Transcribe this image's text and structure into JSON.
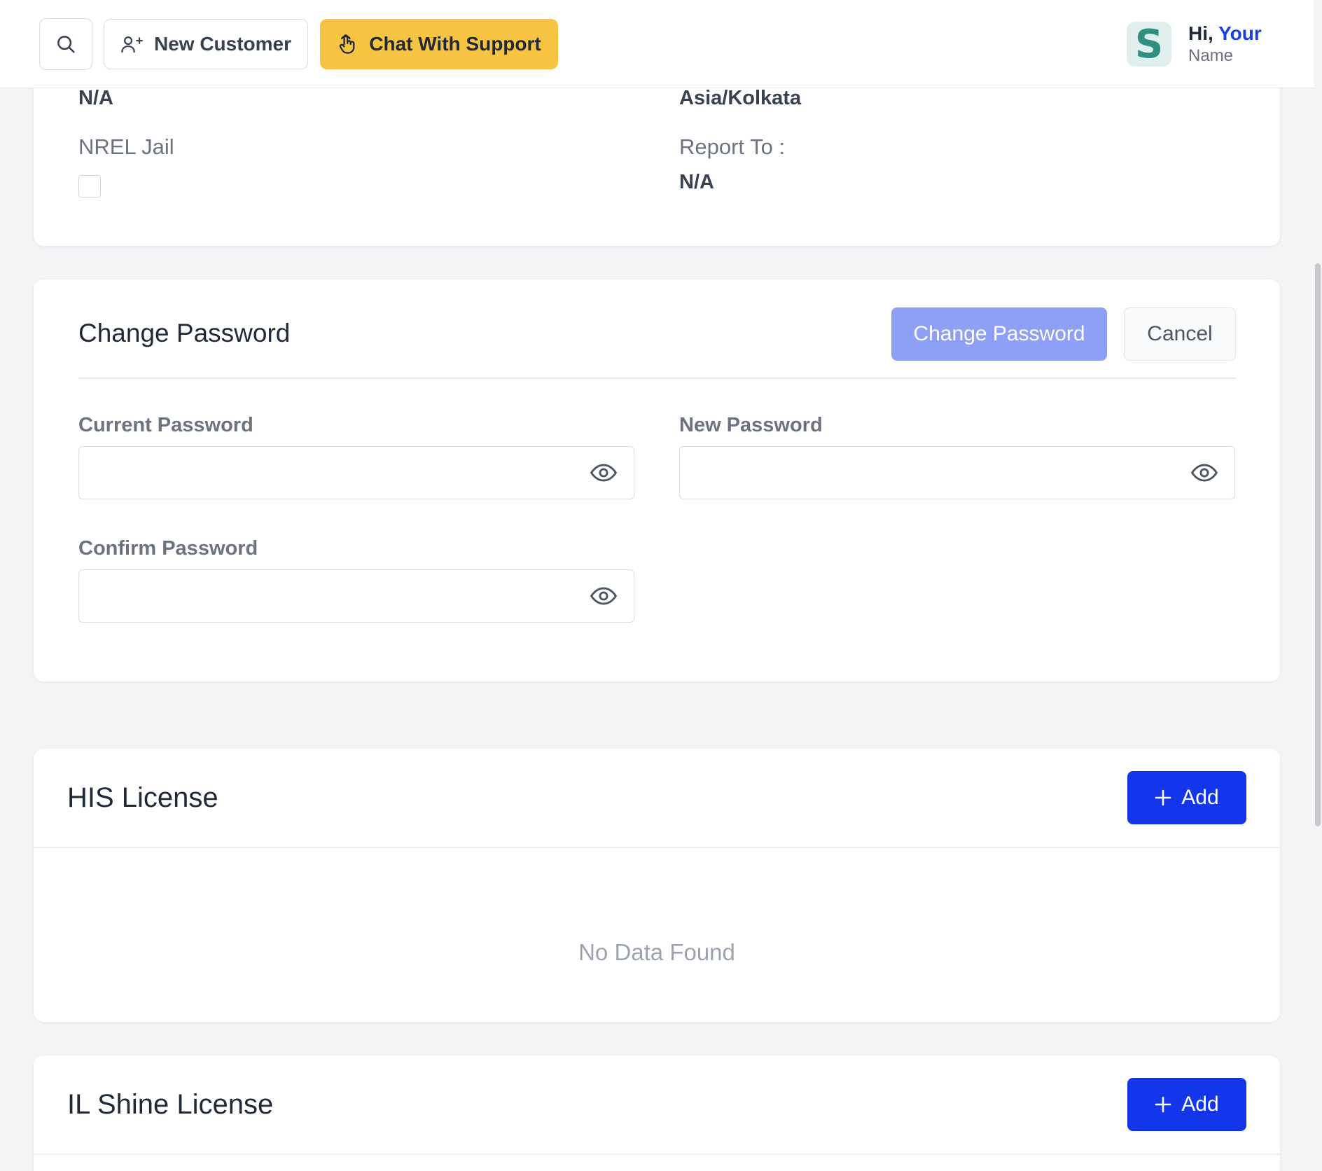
{
  "topbar": {
    "new_customer_label": "New Customer",
    "support_label": "Chat With Support",
    "avatar_letter": "S",
    "greeting_hi": "Hi,",
    "greeting_your": "Your",
    "greeting_name": "Name",
    "support_color": "#f6c343"
  },
  "profile": {
    "left_value_top": "N/A",
    "right_value_top": "Asia/Kolkata",
    "nrel_label": "NREL Jail",
    "report_to_label": "Report To :",
    "report_to_value": "N/A"
  },
  "change_password": {
    "title": "Change Password",
    "submit_label": "Change Password",
    "cancel_label": "Cancel",
    "current_label": "Current Password",
    "current_value": "",
    "new_label": "New Password",
    "new_value": "",
    "confirm_label": "Confirm Password",
    "confirm_value": ""
  },
  "his_license": {
    "title": "HIS License",
    "add_label": "Add",
    "empty_text": "No Data Found"
  },
  "il_shine_license": {
    "title": "IL Shine License",
    "add_label": "Add"
  },
  "colors": {
    "primary": "#1336eb",
    "primary_light": "#8da0f5",
    "accent_link": "#1c3fe0"
  }
}
